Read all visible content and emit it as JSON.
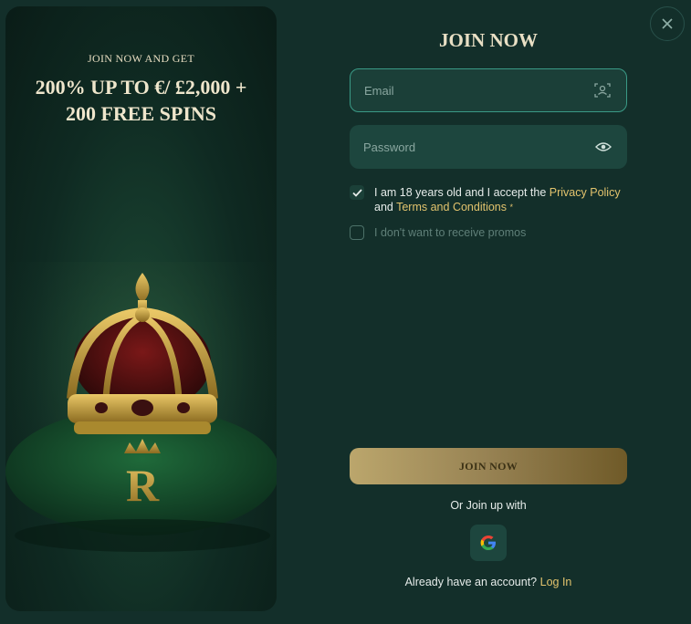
{
  "promo": {
    "kicker": "JOIN NOW AND GET",
    "headline": "200% UP TO €/ £2,000 + 200 FREE SPINS",
    "logo_letter": "R"
  },
  "form": {
    "title": "JOIN NOW",
    "email_placeholder": "Email",
    "password_placeholder": "Password",
    "terms": {
      "checked": true,
      "prefix": "I am 18 years old and I accept the ",
      "privacy_link": "Privacy Policy",
      "middle": " and ",
      "terms_link": "Terms and Conditions",
      "required_mark": "*"
    },
    "promos": {
      "checked": false,
      "label": "I don't want to receive promos"
    },
    "submit_label": "JOIN NOW",
    "or_join_label": "Or Join up with",
    "social_icon": "google-icon",
    "login_prompt": "Already have an account?",
    "login_link": "Log In"
  },
  "close_label": "×",
  "colors": {
    "background": "#132f2a",
    "field": "#1b3f38",
    "accent_gold": "#e2c36d",
    "button_gold_start": "#bba66c",
    "button_gold_end": "#6f5a28"
  }
}
